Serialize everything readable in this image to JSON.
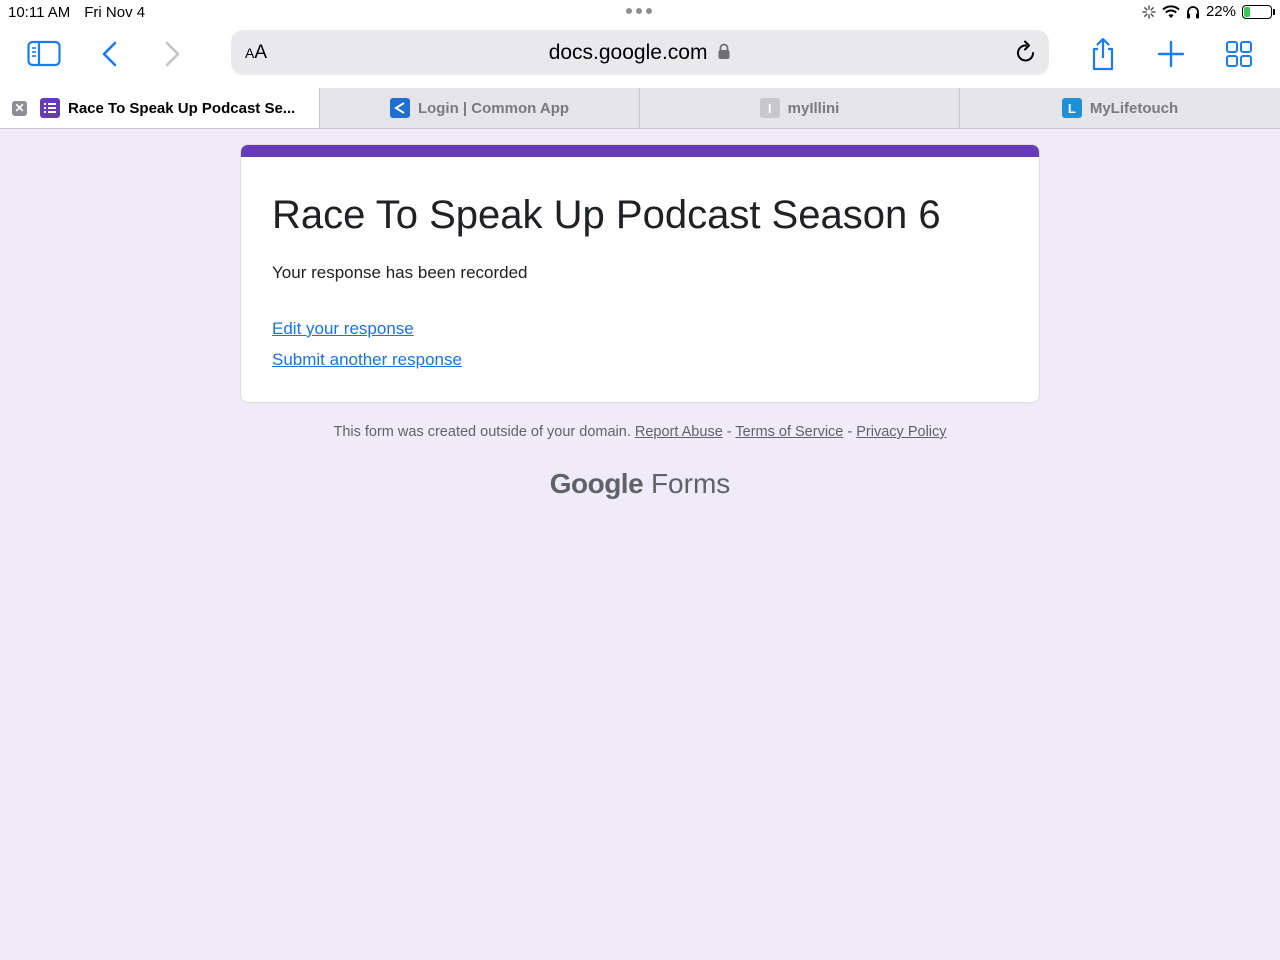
{
  "status": {
    "time": "10:11 AM",
    "date": "Fri Nov 4",
    "battery_text": "22%",
    "battery_level": 0.22
  },
  "toolbar": {
    "text_size_label_small": "A",
    "text_size_label_large": "A",
    "url": "docs.google.com"
  },
  "tabs": [
    {
      "label": "Race To Speak Up Podcast Se...",
      "favicon_letter": "",
      "favicon_color": "#673ab7"
    },
    {
      "label": "Login | Common App",
      "favicon_letter": "",
      "favicon_color": "#1e6fd0"
    },
    {
      "label": "myIllini",
      "favicon_letter": "I",
      "favicon_color": "#c7c7cc"
    },
    {
      "label": "MyLifetouch",
      "favicon_letter": "L",
      "favicon_color": "#1e90d6"
    }
  ],
  "form": {
    "title": "Race To Speak Up Podcast Season 6",
    "message": "Your response has been recorded",
    "edit_link": "Edit your response",
    "submit_another_link": "Submit another response",
    "accent_color": "#673ab7"
  },
  "footer": {
    "notice": "This form was created outside of your domain.",
    "report_abuse": "Report Abuse",
    "separator": " - ",
    "terms": "Terms of Service",
    "privacy": "Privacy Policy"
  },
  "brand": {
    "google": "Google",
    "forms": "Forms"
  }
}
